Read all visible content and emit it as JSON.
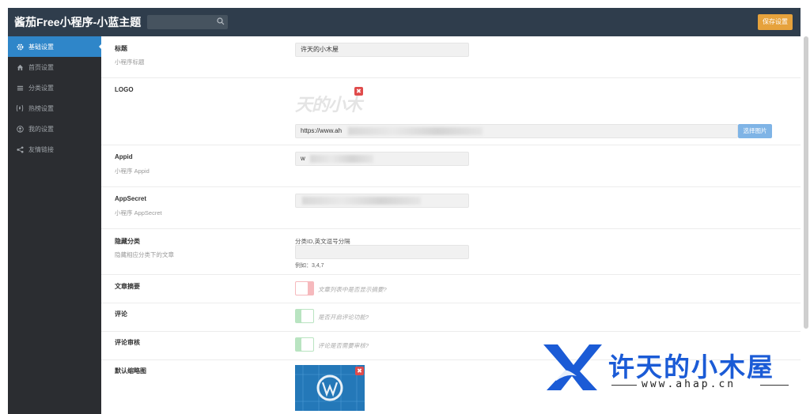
{
  "header": {
    "title": "酱茄Free小程序-小蓝主题",
    "search_placeholder": "",
    "save_label": "保存设置"
  },
  "sidebar": {
    "items": [
      {
        "label": "基础设置",
        "icon": "gear-icon",
        "active": true
      },
      {
        "label": "首页设置",
        "icon": "home-icon"
      },
      {
        "label": "分类设置",
        "icon": "list-icon"
      },
      {
        "label": "热榜设置",
        "icon": "fire-icon"
      },
      {
        "label": "我的设置",
        "icon": "user-icon"
      },
      {
        "label": "友情链接",
        "icon": "share-icon"
      }
    ]
  },
  "form": {
    "title": {
      "label": "标题",
      "desc": "小程序标题",
      "value": "许天的小木屋"
    },
    "logo": {
      "label": "LOGO",
      "logo_text": "天的小木",
      "url_value": "https://www.ah",
      "pick_label": "选择图片"
    },
    "appid": {
      "label": "Appid",
      "desc": "小程序 Appid",
      "value": "w"
    },
    "appsecret": {
      "label": "AppSecret",
      "desc": "小程序 AppSecret",
      "value": ""
    },
    "hidden_cat": {
      "label": "隐藏分类",
      "desc": "隐藏相应分类下的文章",
      "hint": "分类ID,英文逗号分隔",
      "example": "例如：3,4,7",
      "value": ""
    },
    "summary": {
      "label": "文章摘要",
      "toggle_text": "文章列表中是否显示摘要?",
      "state": "off"
    },
    "comment": {
      "label": "评论",
      "toggle_text": "是否开启评论功能?",
      "state": "on"
    },
    "comment_review": {
      "label": "评论审核",
      "toggle_text": "评论是否需要审核?",
      "state": "on"
    },
    "default_thumb": {
      "label": "默认缩略图"
    }
  },
  "watermark": {
    "name": "许天的小木屋",
    "url": "www.ahap.cn"
  },
  "colors": {
    "header_bg": "#2f3d4c",
    "sidebar_bg": "#2b2d31",
    "active_blue": "#2f86c9",
    "save_orange": "#e6a23c",
    "watermark_blue": "#1b5bd6"
  }
}
